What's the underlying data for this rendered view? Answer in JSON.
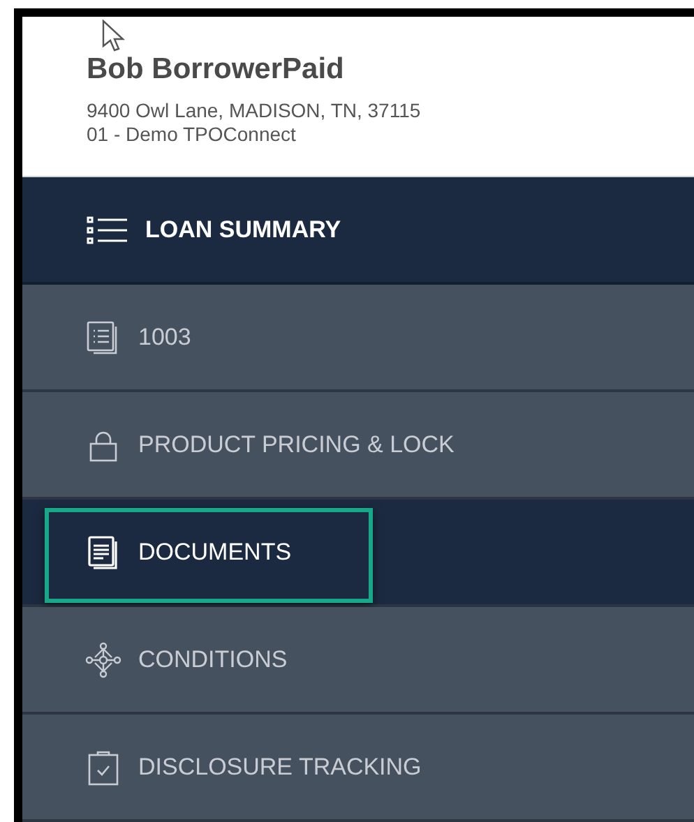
{
  "borrower": {
    "name": "Bob BorrowerPaid",
    "address": "9400 Owl Lane, MADISON, TN, 37115",
    "channel": "01 - Demo TPOConnect"
  },
  "summary": {
    "label": "LOAN SUMMARY"
  },
  "nav": [
    {
      "kind": "form",
      "label": "1003",
      "selected": false,
      "highlighted": false
    },
    {
      "kind": "lock",
      "label": "PRODUCT PRICING & LOCK",
      "selected": false,
      "highlighted": false
    },
    {
      "kind": "documents",
      "label": "DOCUMENTS",
      "selected": true,
      "highlighted": true
    },
    {
      "kind": "conditions",
      "label": "CONDITIONS",
      "selected": false,
      "highlighted": false
    },
    {
      "kind": "disclosure",
      "label": "DISCLOSURE TRACKING",
      "selected": false,
      "highlighted": false
    }
  ]
}
